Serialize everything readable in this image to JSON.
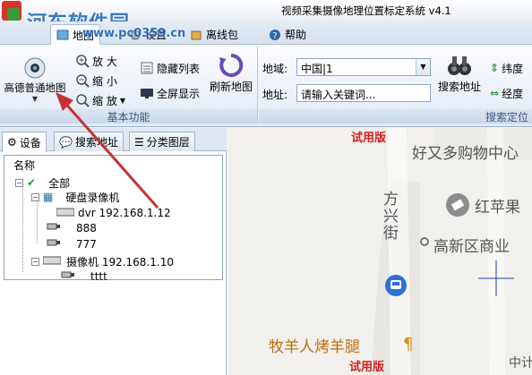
{
  "window": {
    "title": "视频采集摄像地理位置标定系统 v4.1"
  },
  "watermark": {
    "site": "河东软件园",
    "url": "www.pc0359.cn"
  },
  "tabs": [
    {
      "label": "地图",
      "active": true
    },
    {
      "label": "设置",
      "active": false
    },
    {
      "label": "离线包",
      "active": false
    },
    {
      "label": "帮助",
      "active": false
    }
  ],
  "ribbon": {
    "basic": {
      "label": "基本功能",
      "map_type_button": "高德普通地图",
      "zoom_in": "放 大",
      "zoom_out": "缩 小",
      "zoom_menu": "缩 放",
      "hide_list": "隐藏列表",
      "fullscreen": "全屏显示",
      "refresh_map": "刷新地图"
    },
    "search": {
      "label": "搜索定位",
      "region_label": "地域:",
      "region_value": "中国|1",
      "address_label": "地址:",
      "address_placeholder": "请输入关键词...",
      "search_button": "搜索地址",
      "lat_label": "纬度",
      "lng_label": "经度"
    }
  },
  "panel": {
    "tabs": [
      {
        "label": "设备",
        "active": true
      },
      {
        "label": "搜索地址",
        "active": false
      },
      {
        "label": "分类图层",
        "active": false
      }
    ],
    "tree_header": "名称",
    "tree": {
      "root": "全部",
      "dvr_group": "硬盘录像机",
      "dvr_item": "dvr 192.168.1.12",
      "cam_888": "888",
      "cam_777": "777",
      "camera_group": "摄像机 192.168.1.10",
      "cam_tttt": "tttt"
    }
  },
  "map": {
    "trial_top": "试用版",
    "trial_bottom": "试用版",
    "poi_shop": "好又多购物中心",
    "poi_apple": "红苹果",
    "poi_road": "方兴街",
    "poi_gaoxin": "高新区商业",
    "poi_bbq": "牧羊人烤羊腿",
    "poi_corner": "中计"
  },
  "colors": {
    "accent": "#1a64b8",
    "trial": "#d42020",
    "arrow": "#c83232"
  }
}
